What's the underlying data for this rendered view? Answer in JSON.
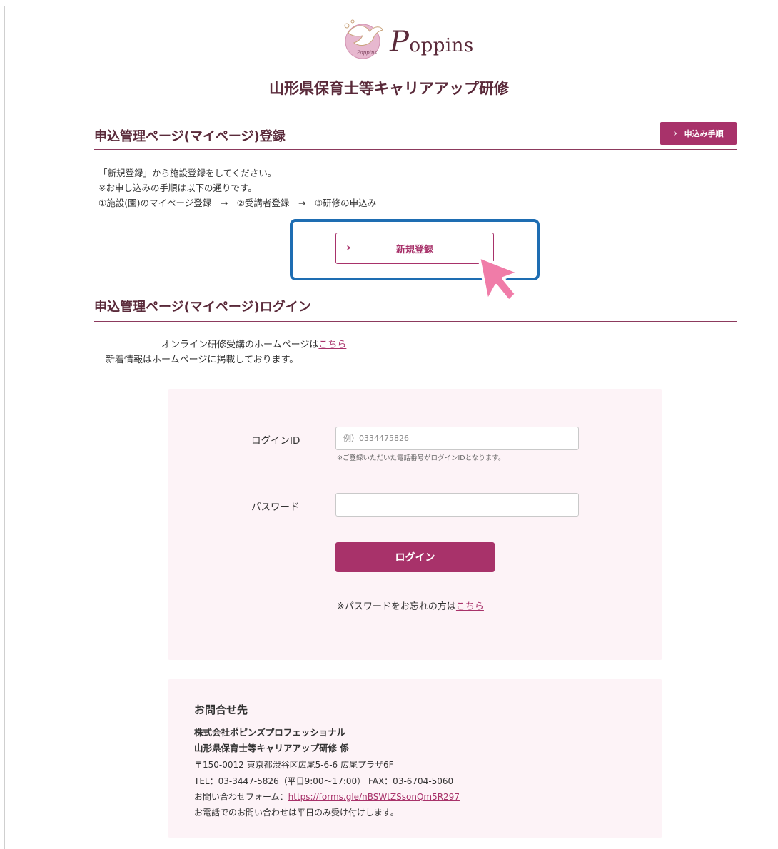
{
  "brand": {
    "name_initial": "P",
    "name_rest": "oppins"
  },
  "page_title": "山形県保育士等キャリアアップ研修",
  "register_section": {
    "title": "申込管理ページ(マイページ)登録",
    "steps_button": "申込み手順",
    "intro_lines": [
      "「新規登録」から施設登録をしてください。",
      "※お申し込みの手順は以下の通りです。",
      "①施設(園)のマイページ登録　→　②受講者登録　→　③研修の申込み"
    ],
    "register_button": "新規登録"
  },
  "login_section": {
    "title": "申込管理ページ(マイページ)ログイン",
    "online_text": "オンライン研修受講のホームページは",
    "online_link": "こちら",
    "news_text": "新着情報はホームページに掲載しております。",
    "login_id_label": "ログインID",
    "login_id_placeholder": "例）0334475826",
    "login_id_hint": "※ご登録いただいた電話番号がログインIDとなります。",
    "password_label": "パスワード",
    "login_button": "ログイン",
    "forgot_text": "※パスワードをお忘れの方は",
    "forgot_link": "こちら"
  },
  "contact": {
    "heading": "お問合せ先",
    "company": "株式会社ポピンズプロフェッショナル",
    "department": "山形県保育士等キャリアアップ研修 係",
    "address": "〒150-0012 東京都渋谷区広尾5-6-6 広尾プラザ6F",
    "phone": "TEL：03-3447-5826（平日9:00～17:00）  FAX：03-6704-5060",
    "form_text": "お問い合わせフォーム：",
    "form_link": "https://forms.gle/nBSWtZSsonQm5R297",
    "note": "お電話でのお問い合わせは平日のみ受け付けします。"
  },
  "colors": {
    "accent": "#a8326a",
    "title": "#5a2a3a",
    "panel_bg": "#fdf3f7",
    "highlight": "#1e6db2",
    "cursor": "#f07ca8"
  }
}
